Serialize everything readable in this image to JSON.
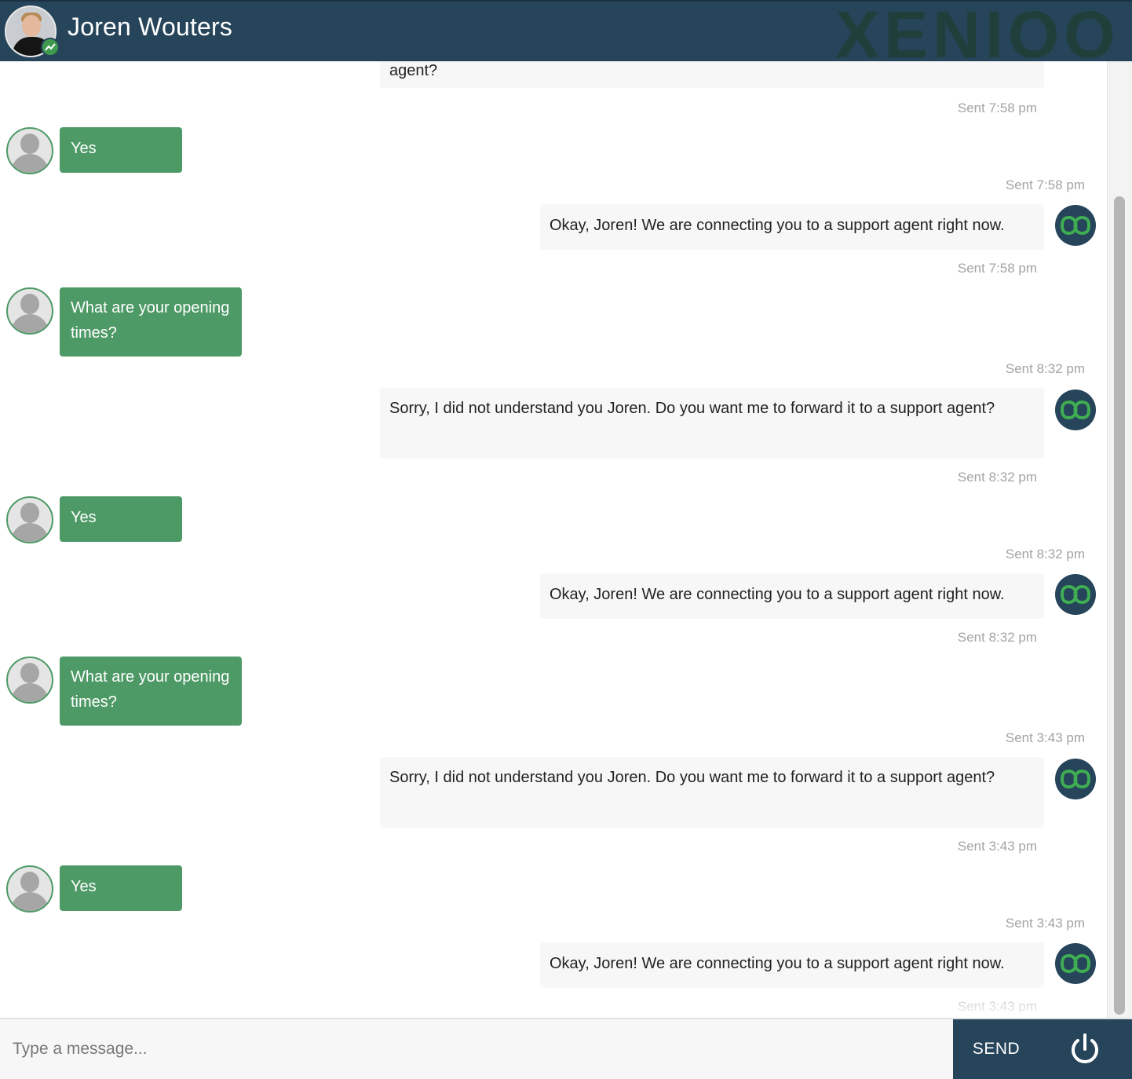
{
  "header": {
    "contact_name": "Joren Wouters",
    "brand_watermark": "XENIOO"
  },
  "colors": {
    "header_bg": "#26445a",
    "user_bubble": "#4e9a67",
    "bot_bubble": "#f7f7f7",
    "timestamp": "#a3a3a3"
  },
  "messages": [
    {
      "from": "bot",
      "text": "agent?",
      "time": "Sent 7:58 pm"
    },
    {
      "from": "user",
      "text": "Yes",
      "time": "Sent 7:58 pm"
    },
    {
      "from": "bot",
      "text": "Okay, Joren! We are connecting you to a support agent right now.",
      "time": "Sent 7:58 pm"
    },
    {
      "from": "user",
      "text": "What are your opening times?",
      "time": "Sent 8:32 pm"
    },
    {
      "from": "bot",
      "text": "Sorry, I did not understand you Joren. Do you want me to forward it to a support agent?",
      "time": "Sent 8:32 pm"
    },
    {
      "from": "user",
      "text": "Yes",
      "time": "Sent 8:32 pm"
    },
    {
      "from": "bot",
      "text": "Okay, Joren! We are connecting you to a support agent right now.",
      "time": "Sent 8:32 pm"
    },
    {
      "from": "user",
      "text": "What are your opening times?",
      "time": "Sent 3:43 pm"
    },
    {
      "from": "bot",
      "text": "Sorry, I did not understand you Joren. Do you want me to forward it to a support agent?",
      "time": "Sent 3:43 pm"
    },
    {
      "from": "user",
      "text": "Yes",
      "time": "Sent 3:43 pm"
    },
    {
      "from": "bot",
      "text": "Okay, Joren! We are connecting you to a support agent right now.",
      "time": "Sent 3:43 pm"
    }
  ],
  "composer": {
    "placeholder": "Type a message...",
    "send_label": "SEND",
    "power_icon": "power-icon"
  }
}
